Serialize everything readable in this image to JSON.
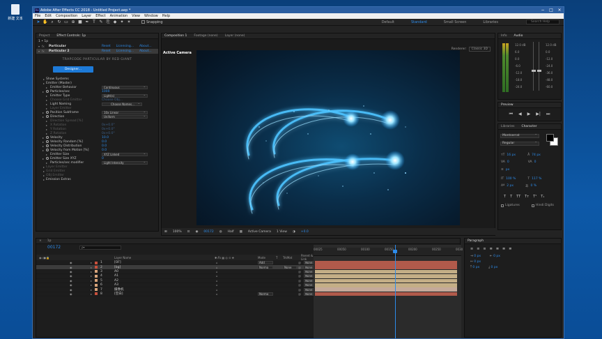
{
  "desktop": {
    "icon_label": "新建 文本"
  },
  "window": {
    "title": "Adobe After Effects CC 2018 - Untitled Project.aep *",
    "app_abbr": "Ae"
  },
  "menu": [
    "File",
    "Edit",
    "Composition",
    "Layer",
    "Effect",
    "Animation",
    "View",
    "Window",
    "Help"
  ],
  "toolbar": {
    "snapping": "Snapping",
    "workspaces": [
      "Default",
      "Standard",
      "Small Screen",
      "Libraries"
    ],
    "active_workspace": "Standard",
    "search_placeholder": "Search Help"
  },
  "effect_panel": {
    "tab_project": "Project",
    "tab_effects": "Effect Controls: 1p",
    "comp_path": "1 • 1p",
    "effects": [
      {
        "name": "Particular",
        "links": [
          "Reset",
          "Licensing...",
          "About..."
        ]
      },
      {
        "name": "Particular 2",
        "links": [
          "Reset",
          "Licensing...",
          "About..."
        ]
      }
    ],
    "brand": "TRAPCODE PARTICULAR BY RED GIANT",
    "designer_label": "Designer...",
    "rows": [
      {
        "name": "Show Systems",
        "type": "group",
        "indent": 1
      },
      {
        "name": "Emitter (Master)",
        "type": "group",
        "indent": 1
      },
      {
        "name": "Emitter Behavior",
        "type": "dd",
        "value": "Continuous"
      },
      {
        "name": "Particles/sec",
        "type": "num",
        "value": "1000",
        "sw": true
      },
      {
        "name": "Emitter Type",
        "type": "dd",
        "value": "Light(s)"
      },
      {
        "name": "Choose Grid Emitter",
        "type": "dim",
        "value": "Choose Obj..."
      },
      {
        "name": "Light Naming",
        "type": "btn",
        "value": "Choose Names..."
      },
      {
        "name": "Layer Emitter",
        "type": "dim",
        "value": ""
      },
      {
        "name": "Position Subframe",
        "type": "dd",
        "value": "10x Linear",
        "sw": true
      },
      {
        "name": "Direction",
        "type": "dd",
        "value": "Uniform",
        "sw": true
      },
      {
        "name": "Direction Spread [%]",
        "type": "dim",
        "value": ""
      },
      {
        "name": "X Rotation",
        "type": "dim",
        "value": "0x+0.0°"
      },
      {
        "name": "Y Rotation",
        "type": "dim",
        "value": "0x+0.0°"
      },
      {
        "name": "Z Rotation",
        "type": "dim",
        "value": "0x+0.0°"
      },
      {
        "name": "Velocity",
        "type": "num",
        "value": "10.0",
        "sw": true
      },
      {
        "name": "Velocity Random [%]",
        "type": "num",
        "value": "0.0",
        "sw": true
      },
      {
        "name": "Velocity Distribution",
        "type": "num",
        "value": "0.0",
        "sw": true
      },
      {
        "name": "Velocity from Motion [%]",
        "type": "num",
        "value": "0.0",
        "sw": true
      },
      {
        "name": "Emitter Size",
        "type": "dd",
        "value": "XYZ Linked"
      },
      {
        "name": "Emitter Size XYZ",
        "type": "num",
        "value": "0",
        "sw": true
      },
      {
        "name": "Particles/sec modifier",
        "type": "dd",
        "value": "Light Intensity"
      },
      {
        "name": "Layer Emitter",
        "type": "dim-group",
        "value": ""
      },
      {
        "name": "Grid Emitter",
        "type": "dim-group",
        "value": ""
      },
      {
        "name": "OBJ Emitter",
        "type": "dim-group",
        "value": ""
      },
      {
        "name": "Emission Extras",
        "type": "group",
        "value": ""
      }
    ]
  },
  "viewer": {
    "tabs": [
      "Composition 1",
      "Footage (none)",
      "Layer (none)"
    ],
    "camera": "Active Camera",
    "renderer_label": "Renderer:",
    "renderer": "Classic 3D",
    "zoom": "100%",
    "timecode": "00172",
    "resolution": "Half",
    "camera_select": "Active Camera",
    "views": "1 View",
    "exposure": "+0.0"
  },
  "info_panel": {
    "tabs": [
      "Info",
      "Audio"
    ],
    "db_values": [
      "12.0 dB",
      "6.0",
      "0.0",
      "-6.0",
      "-12.0",
      "-18.0",
      "-24.0"
    ],
    "db_right": [
      "12.0 dB",
      "0.0",
      "-12.0",
      "-24.0",
      "-36.0",
      "-48.0",
      "-60.0"
    ]
  },
  "preview_panel": {
    "title": "Preview"
  },
  "char_panel": {
    "tabs": [
      "Libraries",
      "Character"
    ],
    "font": "Montserrat",
    "style": "Regular",
    "size": "16 px",
    "leading": "74 px",
    "kern": "0",
    "tracking": "0",
    "stroke": "px",
    "vscale": "100 %",
    "hscale": "117 %",
    "baseline": "2 px",
    "tsume": "0 %",
    "ligatures": "Ligatures",
    "hindi": "Hindi Digits"
  },
  "timeline": {
    "tabs": [
      "1p"
    ],
    "timecode": "00172",
    "columns": {
      "layer_name": "Layer Name",
      "mode": "Mode",
      "t": "T",
      "trkmat": "TrkMat",
      "parent": "Parent & Link"
    },
    "layers": [
      {
        "num": "1",
        "name": "[OF]",
        "color": "#c8503c",
        "mode": "Add",
        "parent": "None",
        "bar": "#b15a4b",
        "sel": false
      },
      {
        "num": "2",
        "name": "[bg]",
        "color": "#c8503c",
        "mode": "Norma",
        "trkmat": "None",
        "parent": "None",
        "bar": "#b15a4b",
        "sel": true
      },
      {
        "num": "3",
        "name": "A0",
        "color": "#d8a47a",
        "parent": "None",
        "bar": "#c4ae86",
        "sel": false
      },
      {
        "num": "4",
        "name": "A1",
        "color": "#d8a47a",
        "parent": "None",
        "bar": "#c4ae86",
        "sel": false
      },
      {
        "num": "5",
        "name": "A2",
        "color": "#d8a47a",
        "parent": "None",
        "bar": "#c4ae86",
        "sel": false
      },
      {
        "num": "6",
        "name": "A3",
        "color": "#d8a47a",
        "parent": "None",
        "bar": "#c4ae86",
        "sel": false
      },
      {
        "num": "7",
        "name": "摄像机",
        "color": "#d8a47a",
        "parent": "None",
        "bar": "#c4a99a",
        "sel": false
      },
      {
        "num": "8",
        "name": "[空白]",
        "color": "#c8503c",
        "mode": "Norma",
        "parent": "None",
        "bar": "#b15a4b",
        "sel": false
      }
    ],
    "ruler": [
      "00025",
      "00050",
      "00100",
      "00150",
      "00200",
      "00250",
      "0030"
    ]
  },
  "para_panel": {
    "title": "Paragraph",
    "vals": [
      "0 px",
      "0 px",
      "0 px",
      "0 px",
      "0 px"
    ]
  },
  "colors": {
    "accent": "#2d8ceb"
  }
}
